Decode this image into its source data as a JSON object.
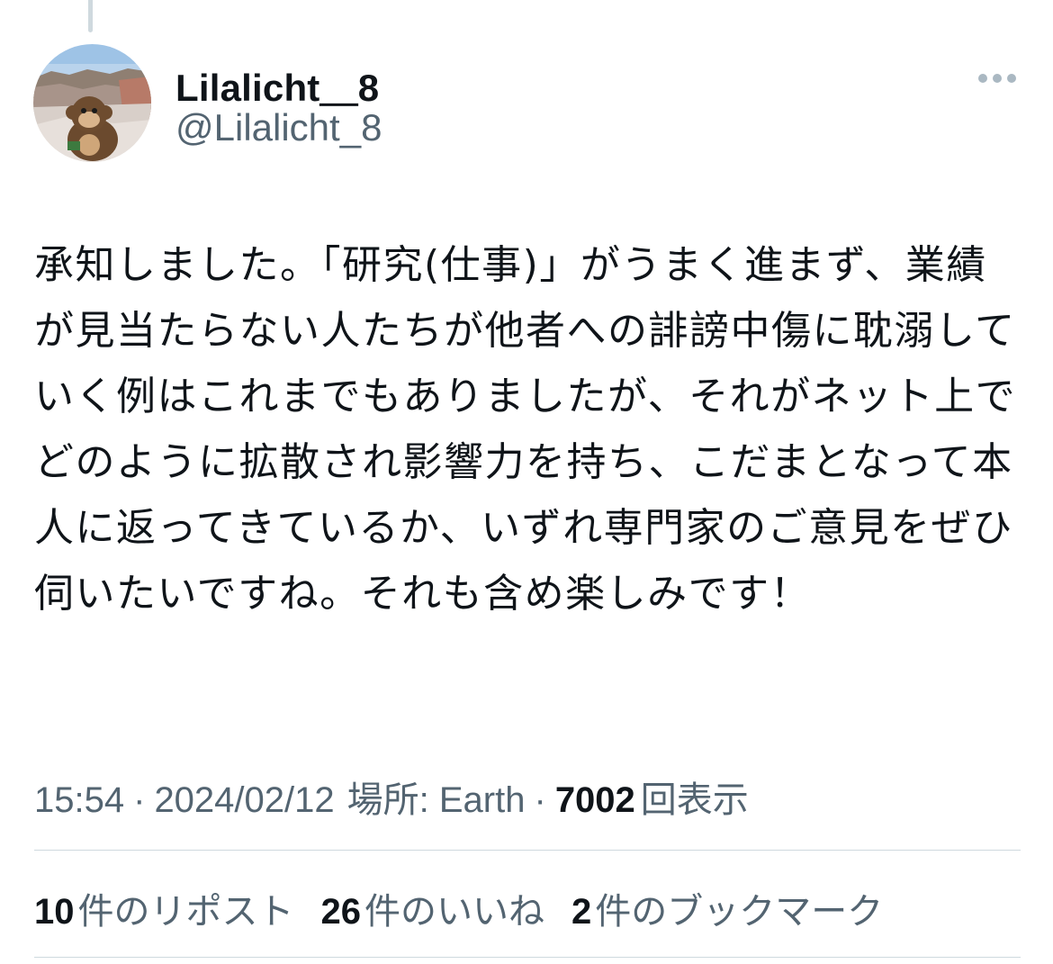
{
  "author": {
    "display_name": "Lilalicht＿8",
    "handle": "@Lilalicht_8"
  },
  "tweet": {
    "text": "承知しました。「研究(仕事)」がうまく進まず、業績が見当たらない人たちが他者への誹謗中傷に耽溺していく例はこれまでもありましたが、それがネット上でどのように拡散され影響力を持ち、こだまとなって本人に返ってきているか、いずれ専門家のご意見をぜひ伺いたいですね。それも含め楽しみです！"
  },
  "meta": {
    "time": "15:54",
    "separator": "·",
    "date": "2024/02/12",
    "location_label": "場所: Earth",
    "views_count": "7002",
    "views_label": "回表示"
  },
  "stats": {
    "reposts": {
      "count": "10",
      "label": "件のリポスト"
    },
    "likes": {
      "count": "26",
      "label": "件のいいね"
    },
    "bookmarks": {
      "count": "2",
      "label": "件のブックマーク"
    }
  },
  "icons": {
    "more": "more-horizontal-icon",
    "avatar": "avatar-image"
  }
}
